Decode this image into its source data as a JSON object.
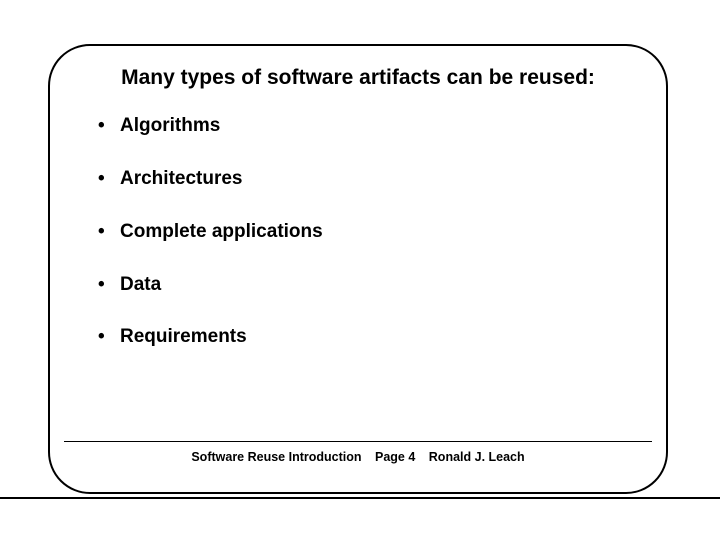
{
  "slide": {
    "title": "Many types of software artifacts can be reused:",
    "bullets": [
      "Algorithms",
      "Architectures",
      "Complete applications",
      "Data",
      "Requirements"
    ],
    "footer": {
      "doc_title": "Software Reuse Introduction",
      "page_label": "Page 4",
      "author": "Ronald J. Leach"
    }
  }
}
